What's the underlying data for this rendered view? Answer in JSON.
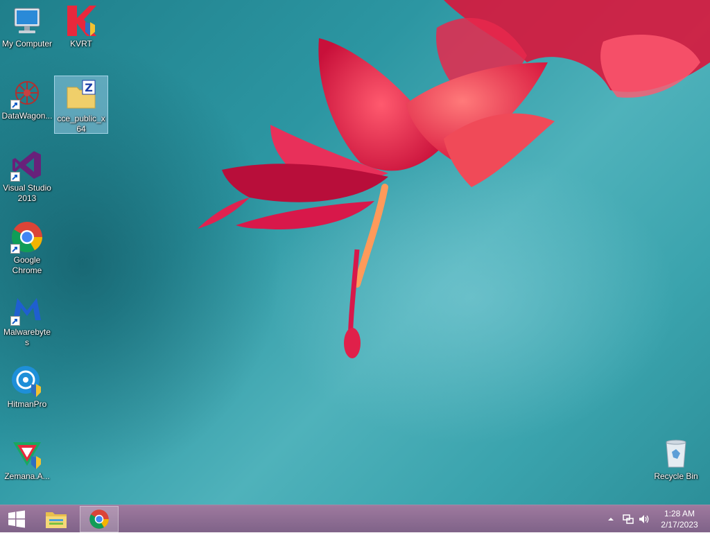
{
  "desktop": {
    "icons": [
      {
        "label": "My Computer",
        "icon": "computer-icon"
      },
      {
        "label": "KVRT",
        "icon": "kvrt-icon"
      },
      {
        "label": "DataWagon...",
        "icon": "datawagon-icon"
      },
      {
        "label": "cce_public_x64",
        "icon": "zip-folder-icon",
        "selected": true
      },
      {
        "label": "Visual Studio 2013",
        "icon": "visual-studio-icon"
      },
      {
        "label": "Google Chrome",
        "icon": "chrome-icon"
      },
      {
        "label": "Malwarebytes",
        "icon": "malwarebytes-icon"
      },
      {
        "label": "HitmanPro",
        "icon": "hitmanpro-icon"
      },
      {
        "label": "Zemana.A...",
        "icon": "zemana-icon"
      },
      {
        "label": "Recycle Bin",
        "icon": "recycle-bin-icon"
      }
    ]
  },
  "taskbar": {
    "start_icon": "windows-logo-icon",
    "pinned": [
      {
        "name": "File Explorer",
        "icon": "file-explorer-icon"
      },
      {
        "name": "Google Chrome",
        "icon": "chrome-icon",
        "active": true
      }
    ],
    "tray": {
      "chevron_icon": "chevron-up-icon",
      "network_icon": "network-icon",
      "volume_icon": "speaker-icon"
    },
    "clock": {
      "time": "1:28 AM",
      "date": "2/17/2023"
    }
  },
  "colors": {
    "wallpaper_teal": "#2c96a2",
    "flower_red": "#e0204a",
    "taskbar": "#8c6c94"
  }
}
